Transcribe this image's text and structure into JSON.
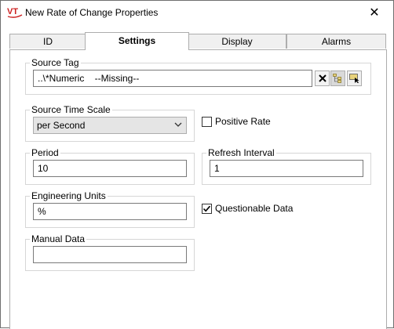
{
  "window": {
    "title": "New Rate of Change Properties",
    "icon_text": "VT",
    "close_glyph": "✕"
  },
  "tabs": [
    {
      "label": "ID",
      "active": false
    },
    {
      "label": "Settings",
      "active": true
    },
    {
      "label": "Display",
      "active": false
    },
    {
      "label": "Alarms",
      "active": false
    }
  ],
  "source_tag": {
    "label": "Source Tag",
    "value": "..\\*Numeric    --Missing--",
    "buttons": [
      "clear-icon",
      "tag-tree-icon",
      "tag-browse-icon"
    ]
  },
  "time_scale": {
    "label": "Source Time Scale",
    "value": "per Second"
  },
  "positive_rate": {
    "label": "Positive Rate",
    "checked": false
  },
  "period": {
    "label": "Period",
    "value": "10"
  },
  "refresh_interval": {
    "label": "Refresh Interval",
    "value": "1"
  },
  "engineering_units": {
    "label": "Engineering Units",
    "value": "%"
  },
  "questionable_data": {
    "label": "Questionable Data",
    "checked": true
  },
  "manual_data": {
    "label": "Manual Data",
    "value": ""
  },
  "colors": {
    "icon_red": "#cc2222",
    "tab_inactive": "#f0f0f0",
    "combo_bg": "#e5e5e5",
    "border": "#adadad"
  }
}
